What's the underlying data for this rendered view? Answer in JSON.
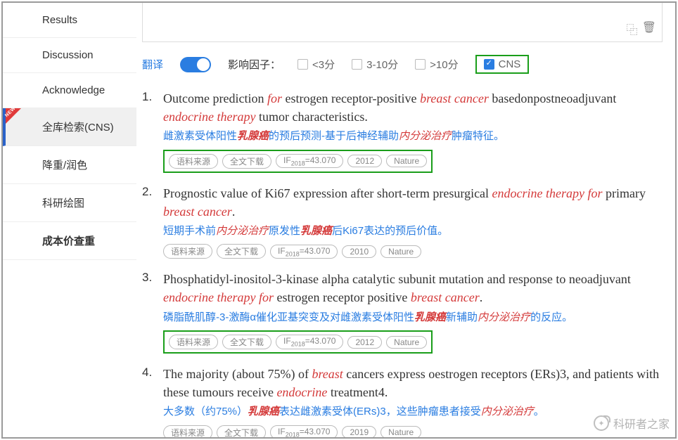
{
  "sidebar": {
    "items": [
      {
        "label": "Results"
      },
      {
        "label": "Discussion"
      },
      {
        "label": "Acknowledge"
      },
      {
        "label": "全库检索(CNS)"
      },
      {
        "label": "降重/润色"
      },
      {
        "label": "科研绘图"
      },
      {
        "label": "成本价查重"
      }
    ]
  },
  "filters": {
    "translate": "翻译",
    "if_label": "影响因子：",
    "opts": [
      "<3分",
      "3-10分",
      ">10分",
      "CNS"
    ]
  },
  "tags": {
    "source": "语料来源",
    "download": "全文下载",
    "if_prefix": "IF",
    "if_year": "2018",
    "if_eq": "=43.070",
    "journal": "Nature"
  },
  "results": [
    {
      "num": "1.",
      "title": {
        "t1": "Outcome prediction ",
        "h1": "for",
        "t2": " estrogen receptor-positive ",
        "h2": "breast cancer",
        "t3": " basedonpostneoadjuvant ",
        "h3": "endocrine therapy",
        "t4": " tumor characteristics."
      },
      "trans": {
        "t1": "雌激素受体阳性",
        "h1": "乳腺癌",
        "t2": "的预后预测-基于后神经辅助",
        "h2": "内分泌治疗",
        "t3": "肿瘤特征。"
      },
      "year": "2012"
    },
    {
      "num": "2.",
      "title": {
        "t1": "Prognostic value of Ki67 expression after short-term presurgical ",
        "h1": "endocrine therapy for",
        "t2": " primary ",
        "h2": "breast cancer",
        "t3": "."
      },
      "trans": {
        "t1": "短期手术前",
        "h1": "内分泌治疗",
        "t2": "原发性",
        "h2": "乳腺癌",
        "t3": "后Ki67表达的预后价值。"
      },
      "year": "2010"
    },
    {
      "num": "3.",
      "title": {
        "t1": "Phosphatidyl-inositol-3-kinase alpha catalytic subunit mutation and response to neoadjuvant ",
        "h1": "endocrine therapy for",
        "t2": " estrogen receptor positive ",
        "h2": "breast cancer",
        "t3": "."
      },
      "trans": {
        "t1": "磷脂酰肌醇-3-激酶α催化亚基突变及对雌激素受体阳性",
        "h1": "乳腺癌",
        "t2": "新辅助",
        "h2": "内分泌治疗",
        "t3": "的反应。"
      },
      "year": "2012"
    },
    {
      "num": "4.",
      "title": {
        "t1": "The majority (about 75%) of ",
        "h1": "breast",
        "t2": " cancers express oestrogen receptors (ERs)3, and patients with these tumours receive ",
        "h2": "endocrine",
        "t3": " treatment4."
      },
      "trans": {
        "t1": "大多数（约75%）",
        "h1": "乳腺癌",
        "t2": "表达雌激素受体(ERs)3，这些肿瘤患者接受",
        "h2": "内分泌治疗",
        "t3": "。"
      },
      "year": "2019"
    }
  ],
  "watermark": "科研者之家"
}
